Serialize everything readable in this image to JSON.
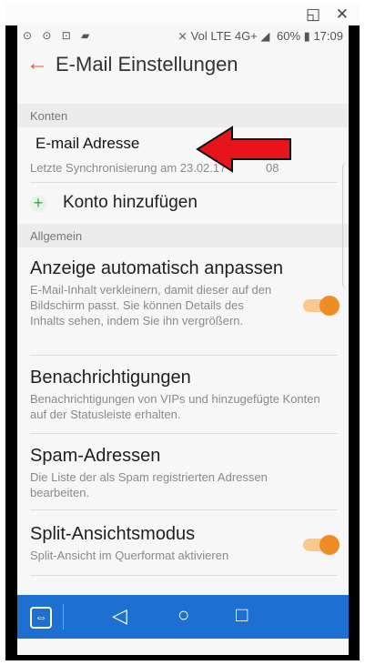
{
  "window": {
    "title_icons": "◱ ✕"
  },
  "statusbar": {
    "left_icons": "⊙ ⊙ ⊡ ▰",
    "right_icons": "⨯ Vol LTE 4G+ ◢",
    "battery": "60%",
    "time": "17:09"
  },
  "appbar": {
    "back_icon": "←",
    "title": "E-Mail Einstellungen"
  },
  "sections": {
    "accounts": "Konten",
    "general": "Allgemein"
  },
  "account": {
    "email_label": "E-mail Adresse",
    "sync": "Letzte Synchronisierung am 23.02.17",
    "sync_time_end": "08"
  },
  "add_account": {
    "icon": "+",
    "label": "Konto hinzufügen"
  },
  "settings": [
    {
      "title": "Anzeige automatisch anpassen",
      "subtitle": "E-Mail-Inhalt verkleinern, damit dieser auf den Bildschirm passt. Sie können Details des Inhalts sehen, indem Sie ihn vergrößern.",
      "toggle": true
    },
    {
      "title": "Benachrichtigungen",
      "subtitle": "Benachrichtigungen von VIPs und hinzugefügte Konten auf der Statusleiste erhalten."
    },
    {
      "title": "Spam-Adressen",
      "subtitle": "Die Liste der als Spam registrierten Adressen bearbeiten."
    },
    {
      "title": "Split-Ansichtsmodus",
      "subtitle": "Split-Ansicht im Querformat aktivieren",
      "toggle": true
    }
  ],
  "navbar": {
    "app_icon": "⇔",
    "back": "◁",
    "home": "○",
    "recent": "□"
  },
  "colors": {
    "accent": "#f08c24",
    "back_arrow": "#e1553a",
    "navbar": "#1d6fd1",
    "annotation_arrow": "#e8141c"
  }
}
